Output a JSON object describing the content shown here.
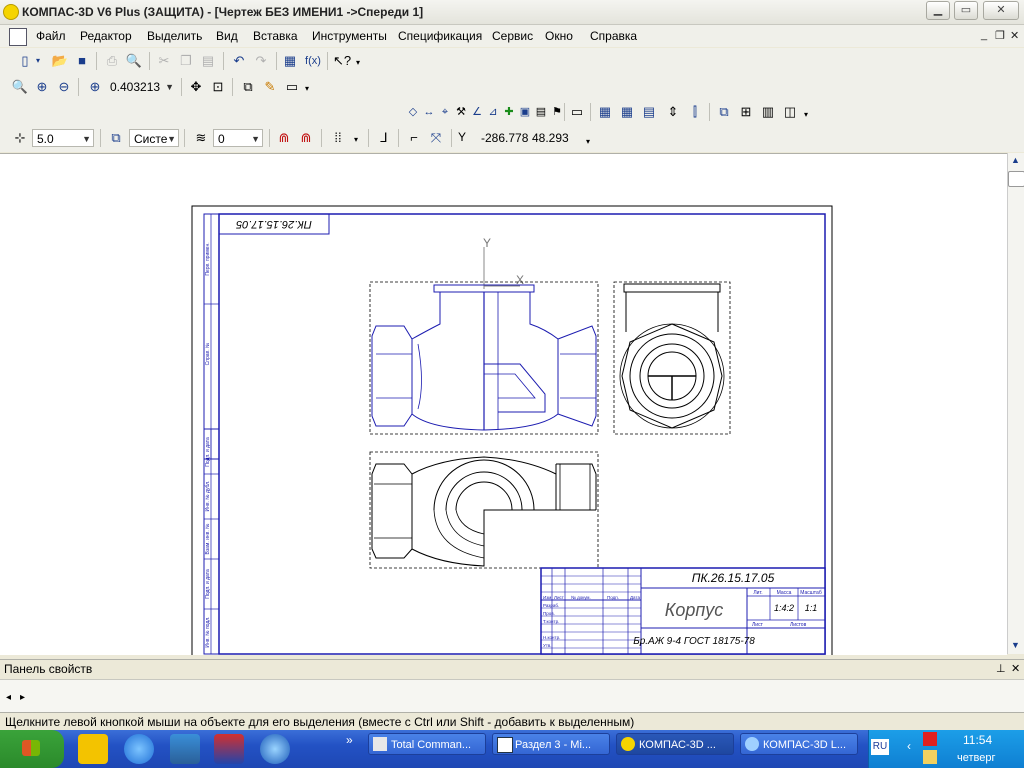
{
  "window": {
    "title": "КОМПАС-3D V6 Plus (ЗАЩИТА) - [Чертеж БЕЗ ИМЕНИ1 ->Спереди 1]",
    "min_glyph": "▁",
    "max_glyph": "▭",
    "close_glyph": "✕"
  },
  "menu": {
    "items": [
      "Файл",
      "Редактор",
      "Выделить",
      "Вид",
      "Вставка",
      "Инструменты",
      "Спецификация",
      "Сервис",
      "Окно",
      "Справка"
    ],
    "mdi_min": "_",
    "mdi_restore": "❐",
    "mdi_close": "✕"
  },
  "toolbar_view": {
    "zoom_value": "0.403213"
  },
  "toolbar_params": {
    "step_value": "5.0",
    "cs_value": "Систе",
    "layer_value": "0",
    "coord_y_label": "Y",
    "coord_x_value": "-286.778",
    "coord_y_value": "48.293"
  },
  "drawing": {
    "axis_y": "Y",
    "axis_x": "X",
    "doc_code_rotated": "ПК.26.15.17.05",
    "doc_code": "ПК.26.15.17.05",
    "part_name": "Корпус",
    "material": "Бр.АЖ 9-4  ГОСТ 18175-78",
    "scale_mass": "1:4:2",
    "sheet_count": "1:1",
    "col_lit": "Лит.",
    "col_mass": "Масса",
    "col_scale": "Масштаб",
    "sheet_label": "Лист",
    "sheets_label": "Листов",
    "row_izm": "Изм",
    "row_list": "Лист",
    "row_doc": "№ докум.",
    "row_sign": "Подп.",
    "row_date": "Дата",
    "row_razrab": "Разраб.",
    "row_prov": "Пров.",
    "row_tkontr": "Т.контр.",
    "row_nkontr": "Н.контр.",
    "row_utv": "Утв.",
    "side_labels": [
      "Перв. примен.",
      "Справ. №",
      "Подп. и дата",
      "Инв. № дубл.",
      "Взам. инв. №",
      "Подп. и дата",
      "Инв. № подл."
    ]
  },
  "panel": {
    "title": "Панель свойств",
    "pin_glyph": "⊥",
    "close_glyph": "✕",
    "nav_left": "◂",
    "nav_right": "▸"
  },
  "status": {
    "text": "Щелкните левой кнопкой мыши на объекте для его выделения (вместе с Ctrl или Shift - добавить к выделенным)"
  },
  "taskbar": {
    "more_glyph": "»",
    "tasks": [
      "Total Comman...",
      "Раздел 3 - Mi...",
      "КОМПАС-3D ...",
      "КОМПАС-3D L..."
    ],
    "lang": "RU",
    "time": "11:54",
    "day": "четверг"
  },
  "colors": {
    "frame": "#1c1cb0",
    "part": "#1c1cb0",
    "taskbar": "#2352c4",
    "tray": "#0f7fd2"
  }
}
